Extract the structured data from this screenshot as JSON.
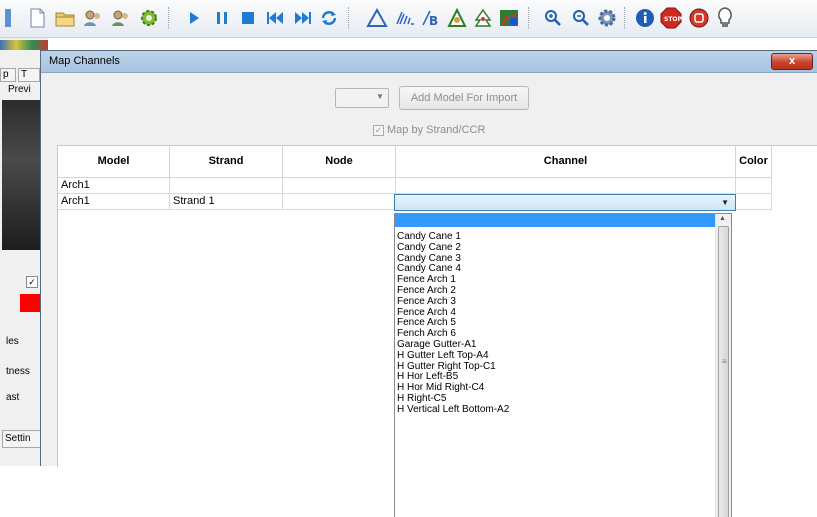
{
  "toolbar": {
    "icons": [
      "new-file-icon",
      "open-folder-icon",
      "user-group-icon",
      "user-group-2-icon",
      "gear-green-icon",
      "play-icon",
      "pause-icon",
      "stop-icon",
      "skip-back-icon",
      "skip-forward-icon",
      "repeat-icon",
      "triangle-icon",
      "antenna-icon",
      "text-b-icon",
      "effect-icon",
      "tree-icon",
      "chart-icon",
      "zoom-in-icon",
      "zoom-out-icon",
      "settings-icon",
      "info-icon",
      "stop-sign-icon",
      "record-icon",
      "bulb-icon"
    ],
    "colors": {
      "play": "#1f7ad3",
      "stop_sign": "#d22a1e",
      "info": "#1d5fb8"
    }
  },
  "left_panel": {
    "tab_1": "p",
    "tab_2": "T",
    "tab_preview": "Previ",
    "label_es": "les",
    "label_ness": "tness",
    "label_ast": "ast",
    "settings_tab": "Settin",
    "swatch_color": "#ff0000"
  },
  "dialog": {
    "title": "Map Channels",
    "close_label": "x",
    "combo_value": "",
    "add_model_label": "Add Model For Import",
    "map_by_strand_label": "Map by Strand/CCR",
    "map_by_strand_checked": true
  },
  "grid": {
    "columns": [
      "Model",
      "Strand",
      "Node",
      "Channel",
      "Color"
    ],
    "rows": [
      {
        "model": "Arch1",
        "strand": "",
        "node": "",
        "channel": "",
        "color": ""
      },
      {
        "model": "Arch1",
        "strand": "Strand 1",
        "node": "",
        "channel": "",
        "color": ""
      }
    ]
  },
  "channel_dropdown": {
    "selected_value": "",
    "options": [
      "Candy Cane 1",
      "Candy Cane 2",
      "Candy Cane 3",
      "Candy Cane 4",
      "Fence Arch 1",
      "Fence Arch 2",
      "Fence Arch 3",
      "Fence Arch 4",
      "Fence Arch 5",
      "Fench Arch 6",
      "Garage Gutter-A1",
      "H Gutter Left Top-A4",
      "H Gutter Right Top-C1",
      "H Hor Left-B5",
      "H Hor Mid Right-C4",
      "H Right-C5",
      "H Vertical Left Bottom-A2"
    ]
  }
}
